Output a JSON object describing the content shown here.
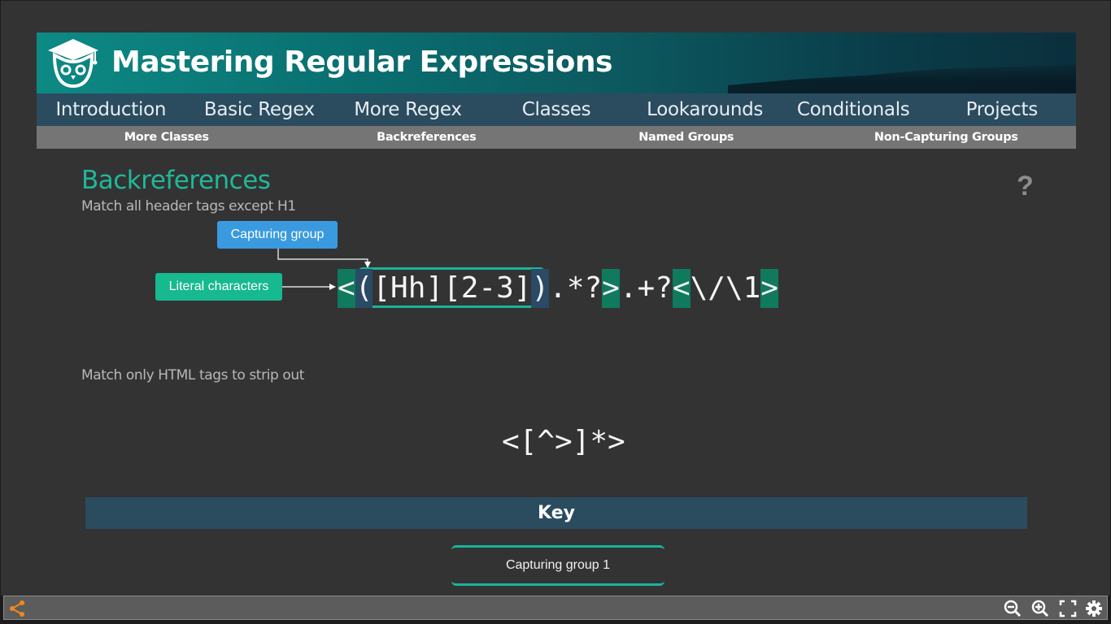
{
  "header": {
    "title": "Mastering Regular Expressions"
  },
  "nav": {
    "items": [
      "Introduction",
      "Basic Regex",
      "More Regex",
      "Classes",
      "Lookarounds",
      "Conditionals",
      "Projects"
    ]
  },
  "subnav": {
    "items": [
      "More Classes",
      "Backreferences",
      "Named Groups",
      "Non-Capturing Groups"
    ]
  },
  "main": {
    "title": "Backreferences",
    "example1_desc": "Match all header tags except H1",
    "callout_capture": "Capturing group",
    "callout_literal": "Literal characters",
    "regex1": {
      "lt": "<",
      "open": "(",
      "body": "[Hh][2-3]",
      "close": ")",
      "mid": ".*?",
      "gt": ">",
      "mid2": ".+?",
      "lt2": "<",
      "tail": "\\/\\1",
      "gt2": ">"
    },
    "example2_desc": "Match only HTML tags to strip out",
    "regex2": "<[^>]*>",
    "help": "?"
  },
  "key": {
    "title": "Key",
    "item": "Capturing group 1"
  },
  "colors": {
    "accent": "#1fb89a",
    "literal": "#0f7a5e",
    "group": "#2a4a66",
    "callout_blue": "#3a9ae0",
    "callout_green": "#17b98f",
    "nav": "#2b4b5f"
  },
  "toolbar": {
    "icons": [
      "share-icon",
      "zoom-out-icon",
      "zoom-in-icon",
      "fullscreen-icon",
      "gear-icon"
    ]
  }
}
